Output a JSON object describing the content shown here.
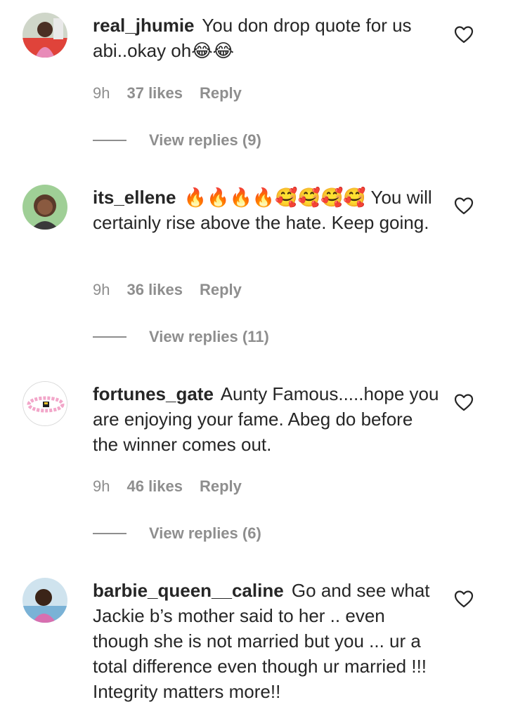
{
  "comments": [
    {
      "username": "real_jhumie",
      "text": "You don drop quote for us abi..okay oh😂😂",
      "time": "9h",
      "likes": "37 likes",
      "reply_label": "Reply",
      "view_replies": "View replies (9)"
    },
    {
      "username": "its_ellene",
      "text": "🔥🔥🔥🔥🥰🥰🥰🥰 You will certainly rise above the hate. Keep going.",
      "time": "9h",
      "likes": "36 likes",
      "reply_label": "Reply",
      "view_replies": "View replies (11)"
    },
    {
      "username": "fortunes_gate",
      "text": "Aunty Famous.....hope you are enjoying your fame. Abeg do before the winner comes out.",
      "time": "9h",
      "likes": "46 likes",
      "reply_label": "Reply",
      "view_replies": "View replies (6)"
    },
    {
      "username": "barbie_queen__caline",
      "text": "Go and see what Jackie b’s mother said to her .. even though she is not married but you ... ur a total difference even though ur married !!! Integrity matters more!!"
    }
  ],
  "colors": {
    "text": "#262626",
    "meta": "#8e8e8e",
    "background": "#ffffff"
  },
  "icons": {
    "like": "heart-outline-icon"
  }
}
